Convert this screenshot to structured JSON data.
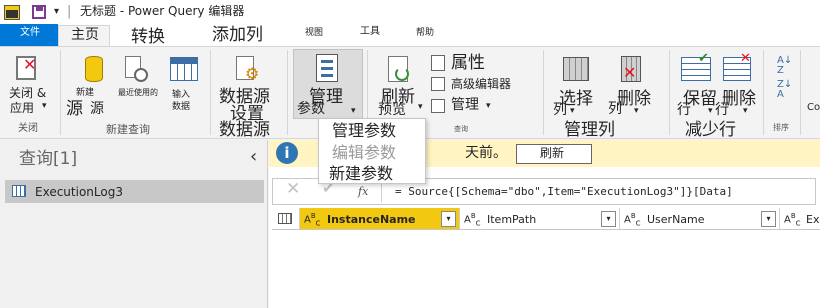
{
  "title_bar": {
    "separator": "|",
    "title": "无标题 - Power Query 编辑器"
  },
  "tabs": {
    "file": "文件",
    "home": "主页",
    "transform": "转换",
    "add_column": "添加列",
    "view": "视图",
    "tools": "工具",
    "help": "帮助"
  },
  "ribbon": {
    "close_apply": "关闭 &",
    "close_apply_2": "应用",
    "new_source": "新建",
    "new_source_2": "源",
    "recent_sources": "最近使用的",
    "recent_sources_2": "源",
    "enter_data": "输入",
    "enter_data_2": "数据",
    "data_source_settings": "数据源",
    "data_source_settings_2": "设置",
    "manage_parameters": "管理",
    "manage_parameters_2": "参数",
    "refresh": "刷新",
    "refresh_2": "预览",
    "properties": "属性",
    "advanced_editor": "高级编辑器",
    "manage": "管理",
    "query_group_partial": "查询",
    "choose_columns": "选择",
    "choose_columns_2": "列",
    "remove_columns": "删除",
    "remove_columns_2": "列",
    "keep_rows": "保留",
    "keep_rows_2": "行",
    "remove_rows": "删除",
    "remove_rows_2": "行",
    "combine_partial": "Co",
    "group_close": "关闭",
    "group_new_query": "新建查询",
    "group_data_sources": "数据源",
    "group_manage_columns": "管理列",
    "group_reduce_rows": "减少行",
    "group_sort": "排序"
  },
  "dropdown_menu": {
    "items": [
      "管理参数",
      "编辑参数",
      "新建参数"
    ]
  },
  "queries_pane": {
    "header": "查询[1]",
    "items": [
      "ExecutionLog3"
    ]
  },
  "info_bar": {
    "message_partial": "天前。",
    "refresh_button": "刷新"
  },
  "formula_bar": {
    "fx": "fx",
    "formula": "= Source{[Schema=\"dbo\",Item=\"ExecutionLog3\"]}[Data]"
  },
  "columns": [
    "InstanceName",
    "ItemPath",
    "UserName",
    "Ex"
  ],
  "colors": {
    "accent": "#0078d7",
    "selected_column": "#f2c811",
    "info_bar": "#fff4c2",
    "info_icon": "#2e75b6"
  }
}
